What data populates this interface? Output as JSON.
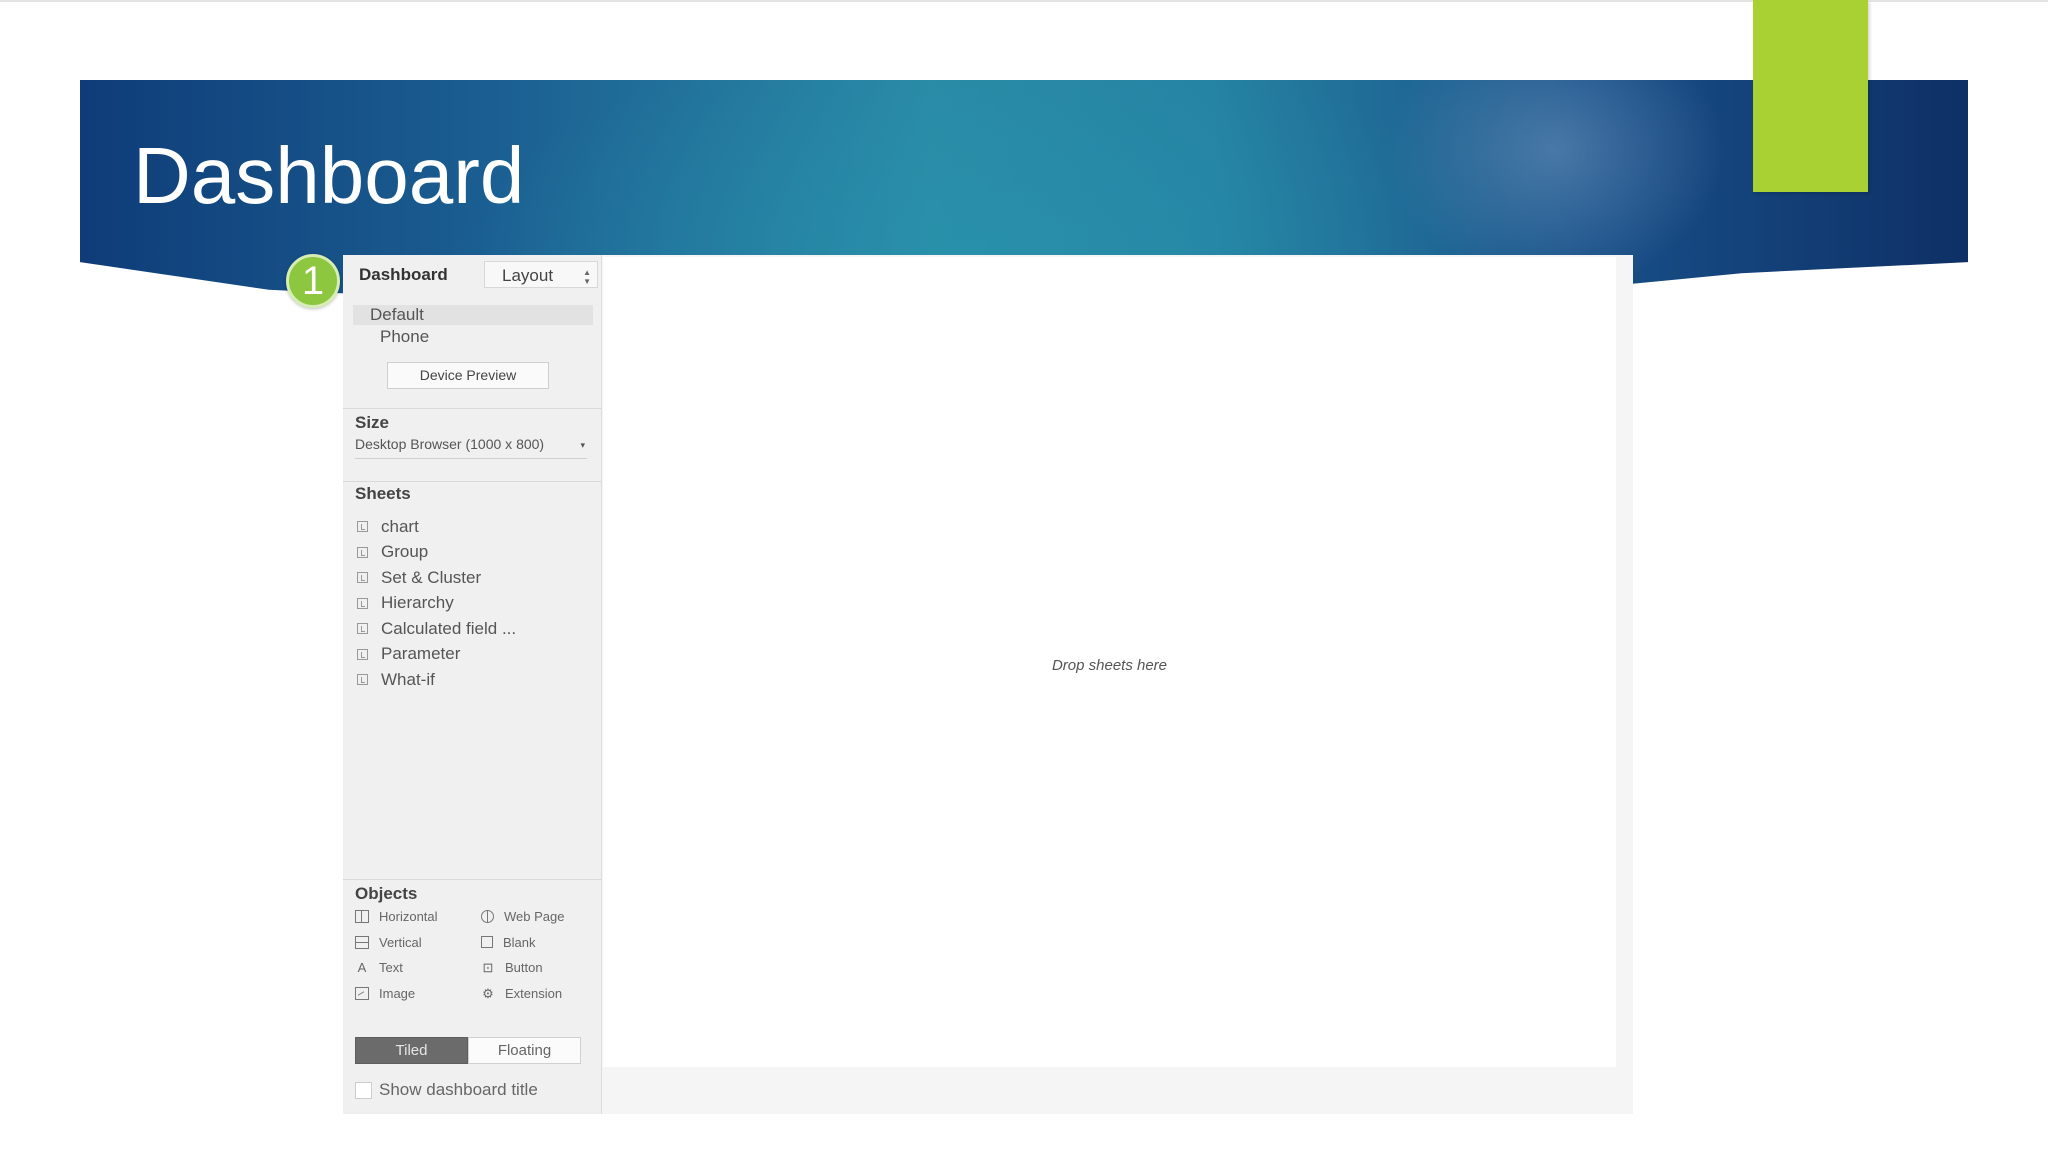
{
  "slide": {
    "title": "Dashboard",
    "badge_number": "1",
    "accent_color": "#a9d133",
    "banner_colors": [
      "#0f3c78",
      "#2a8aa6",
      "#0e3066"
    ]
  },
  "panel": {
    "tabs": {
      "dashboard": "Dashboard",
      "layout": "Layout"
    },
    "device": {
      "default": "Default",
      "phone": "Phone",
      "preview_button": "Device Preview"
    },
    "size": {
      "heading": "Size",
      "value": "Desktop Browser (1000 x 800)"
    },
    "sheets": {
      "heading": "Sheets",
      "items": [
        "chart",
        "Group",
        "Set & Cluster",
        "Hierarchy",
        "Calculated field ...",
        "Parameter",
        "What-if"
      ]
    },
    "objects": {
      "heading": "Objects",
      "items": [
        {
          "label": "Horizontal",
          "icon": "horizontal-container-icon"
        },
        {
          "label": "Web Page",
          "icon": "globe-icon"
        },
        {
          "label": "Vertical",
          "icon": "vertical-container-icon"
        },
        {
          "label": "Blank",
          "icon": "blank-icon"
        },
        {
          "label": "Text",
          "icon": "text-icon"
        },
        {
          "label": "Button",
          "icon": "button-icon"
        },
        {
          "label": "Image",
          "icon": "image-icon"
        },
        {
          "label": "Extension",
          "icon": "puzzle-icon"
        }
      ]
    },
    "mode": {
      "tiled": "Tiled",
      "floating": "Floating",
      "selected": "Tiled"
    },
    "show_title": {
      "label": "Show dashboard title",
      "checked": false
    }
  },
  "canvas": {
    "placeholder": "Drop sheets here"
  }
}
